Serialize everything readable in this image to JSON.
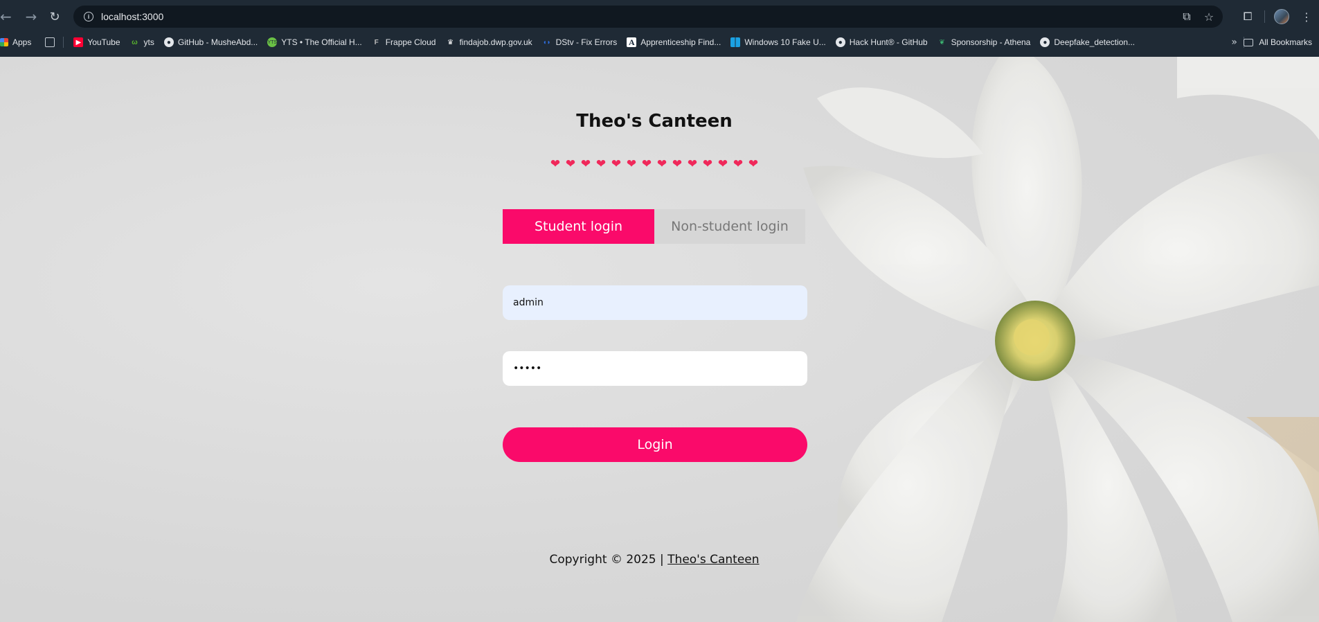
{
  "browser": {
    "url": "localhost:3000",
    "bookmarks": [
      {
        "label": "Apps",
        "icon": "apps-icon"
      },
      {
        "label": "YouTube",
        "icon": "youtube-icon"
      },
      {
        "label": "yts",
        "icon": "yts-icon"
      },
      {
        "label": "GitHub - MusheAbd...",
        "icon": "github-icon"
      },
      {
        "label": "YTS • The Official H...",
        "icon": "yts-official-icon"
      },
      {
        "label": "Frappe Cloud",
        "icon": "frappe-icon"
      },
      {
        "label": "findajob.dwp.gov.uk",
        "icon": "crown-icon"
      },
      {
        "label": "DStv - Fix Errors",
        "icon": "dstv-icon"
      },
      {
        "label": "Apprenticeship Find...",
        "icon": "apprenticeship-icon"
      },
      {
        "label": "Windows 10 Fake U...",
        "icon": "windows-icon"
      },
      {
        "label": "Hack Hunt® - GitHub",
        "icon": "github-icon"
      },
      {
        "label": "Sponsorship - Athena",
        "icon": "athena-icon"
      },
      {
        "label": "Deepfake_detection...",
        "icon": "github-icon"
      }
    ],
    "all_bookmarks": "All Bookmarks"
  },
  "page": {
    "title": "Theo's Canteen",
    "hearts": [
      "❤",
      "❤",
      "❤",
      "❤",
      "❤",
      "❤",
      "❤",
      "❤",
      "❤",
      "❤",
      "❤",
      "❤",
      "❤",
      "❤"
    ],
    "tabs": {
      "student": "Student login",
      "non_student": "Non-student login"
    },
    "username_value": "admin",
    "password_value": "•••••",
    "login_label": "Login",
    "footer": {
      "prefix": "Copyright © 2025 | ",
      "link": "Theo's Canteen"
    }
  },
  "colors": {
    "accent": "#fa0a6a",
    "chrome_bg": "#1f2a35",
    "heart": "#f0285a"
  }
}
